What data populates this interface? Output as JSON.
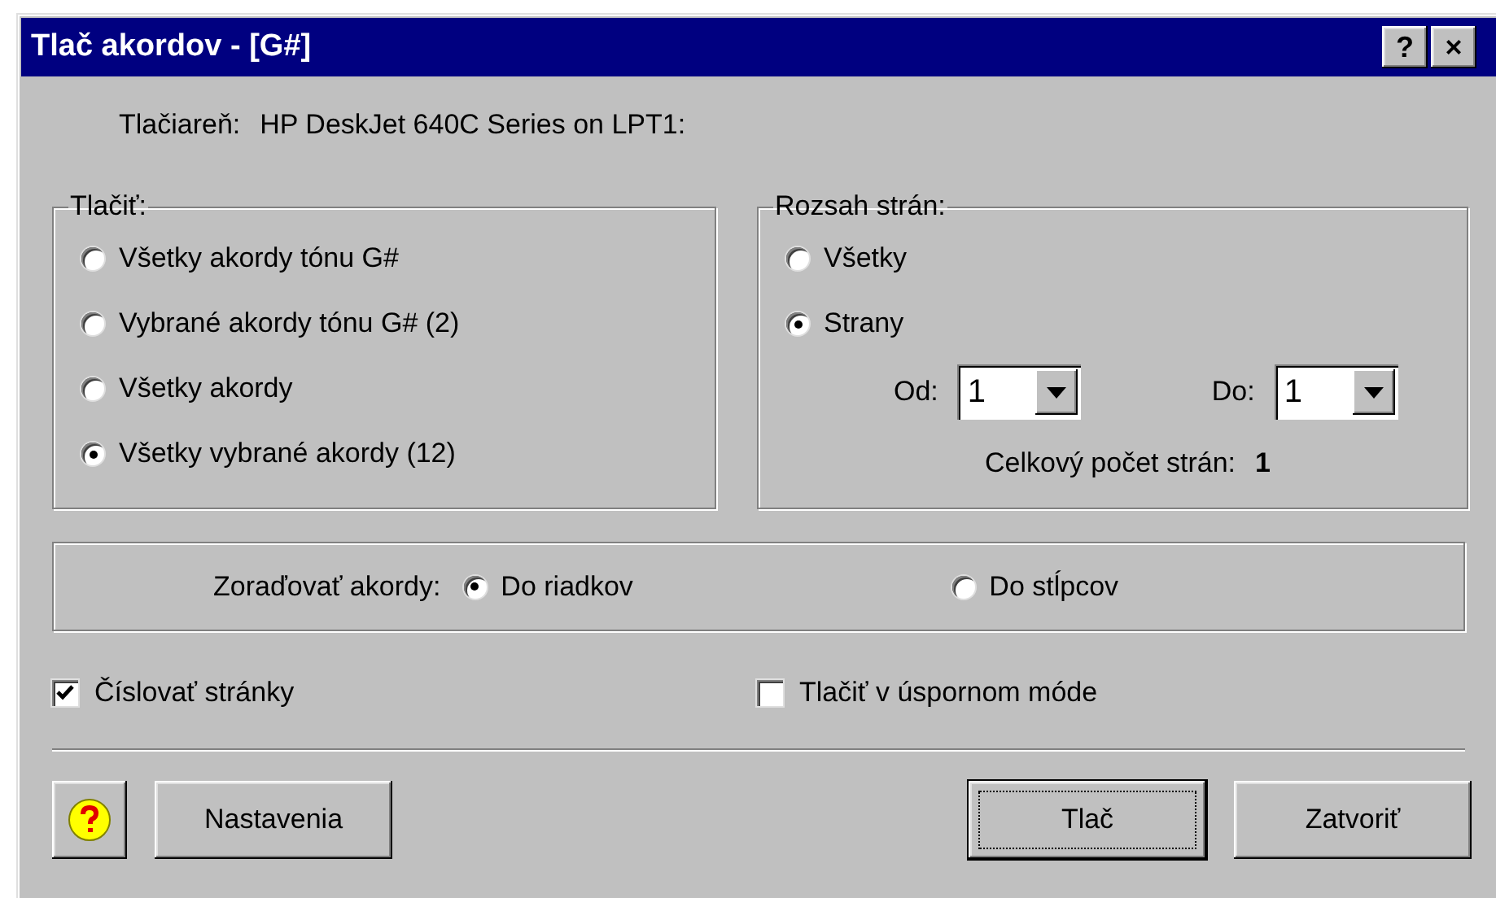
{
  "window": {
    "title": "Tlač akordov - [G#]",
    "help_button": "?",
    "close_button": "×"
  },
  "printer": {
    "label": "Tlačiareň:",
    "value": "HP DeskJet 640C Series on LPT1:"
  },
  "print_group": {
    "title": "Tlačiť:",
    "options": [
      {
        "label": "Všetky akordy tónu G#",
        "selected": false
      },
      {
        "label": "Vybrané akordy tónu G# (2)",
        "selected": false
      },
      {
        "label": "Všetky akordy",
        "selected": false
      },
      {
        "label": "Všetky vybrané akordy (12)",
        "selected": true
      }
    ]
  },
  "page_range": {
    "title": "Rozsah strán:",
    "options": [
      {
        "label": "Všetky",
        "selected": false
      },
      {
        "label": "Strany",
        "selected": true
      }
    ],
    "from": {
      "label": "Od:",
      "value": "1"
    },
    "to": {
      "label": "Do:",
      "value": "1"
    },
    "total_label": "Celkový počet strán:",
    "total_value": "1"
  },
  "sort": {
    "label": "Zoraďovať akordy:",
    "options": [
      {
        "label": "Do riadkov",
        "selected": true
      },
      {
        "label": "Do stĺpcov",
        "selected": false
      }
    ]
  },
  "checkboxes": [
    {
      "label": "Číslovať stránky",
      "checked": true
    },
    {
      "label": "Tlačiť v úspornom móde",
      "checked": false
    }
  ],
  "left_buttons": [
    {
      "kind": "help"
    },
    {
      "kind": "text",
      "label": "Nastavenia",
      "default": false
    }
  ],
  "right_buttons": [
    {
      "kind": "text",
      "label": "Tlač",
      "default": true
    },
    {
      "kind": "text",
      "label": "Zatvoriť",
      "default": false
    }
  ]
}
